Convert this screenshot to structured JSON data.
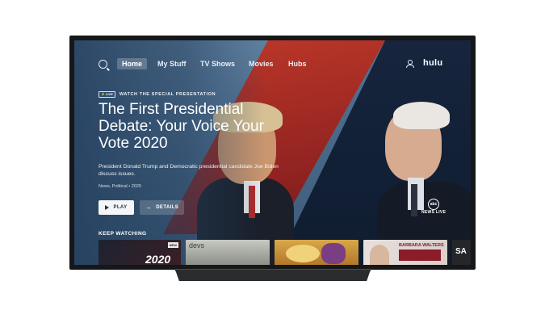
{
  "nav": {
    "items": [
      {
        "label": "Home",
        "active": true
      },
      {
        "label": "My Stuff",
        "active": false
      },
      {
        "label": "TV Shows",
        "active": false
      },
      {
        "label": "Movies",
        "active": false
      },
      {
        "label": "Hubs",
        "active": false
      }
    ],
    "logo": "hulu",
    "icons": {
      "search": "search-icon",
      "profile": "user-icon"
    }
  },
  "hero": {
    "live_badge": "LIVE",
    "kicker": "WATCH THE SPECIAL PRESENTATION",
    "title": "The First Presidential Debate: Your Voice Your Vote 2020",
    "description": "President Donald Trump and Democratic presidential candidate Joe Biden discuss issues.",
    "meta": "News, Political • 2020",
    "play_label": "PLAY",
    "details_label": "DETAILS",
    "network_logo": "abc",
    "network_label": "NEWS LIVE"
  },
  "keep_watching": {
    "label": "KEEP WATCHING",
    "tiles": [
      {
        "text": "2020",
        "badge": "NEW"
      },
      {
        "text": "devs"
      },
      {
        "text": ""
      },
      {
        "text": "BARBARA WALTERS"
      },
      {
        "text": "SA"
      }
    ]
  },
  "colors": {
    "accent": "#ffffff",
    "brand_red": "#b22a22",
    "brand_blue": "#1a2a44"
  }
}
